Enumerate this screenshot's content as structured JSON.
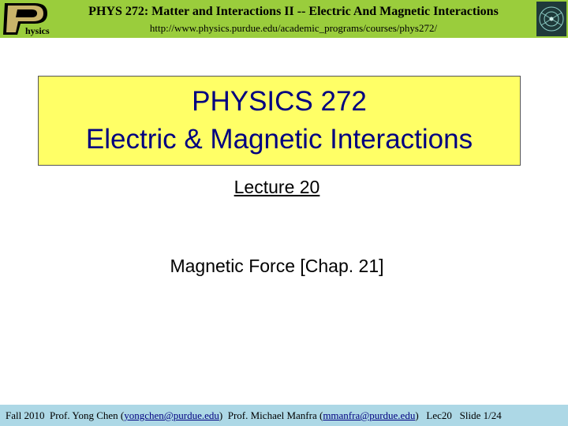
{
  "header": {
    "title": "PHYS 272: Matter and Interactions II -- Electric And Magnetic Interactions",
    "url": "http://www.physics.purdue.edu/academic_programs/courses/phys272/",
    "logo_text": "hysics",
    "logo_icon": "purdue-p-logo",
    "right_logo_icon": "department-seal-logo"
  },
  "slide": {
    "title_line1": "PHYSICS 272",
    "title_line2": "Electric & Magnetic Interactions",
    "lecture": "Lecture 20",
    "topic": "Magnetic Force [Chap. 21]"
  },
  "footer": {
    "term": "Fall 2010",
    "prof1_prefix": "Prof. Yong Chen (",
    "prof1_email": "yongchen@purdue.edu",
    "prof1_suffix": ")",
    "prof2_prefix": "Prof. Michael Manfra (",
    "prof2_email": "mmanfra@purdue.edu",
    "prof2_suffix": ")",
    "lec": "Lec20",
    "slide_num": "Slide 1/24"
  },
  "colors": {
    "header_bg": "#9acd3c",
    "title_box_bg": "#ffff66",
    "title_text": "#000080",
    "footer_bg": "#add8e6"
  }
}
